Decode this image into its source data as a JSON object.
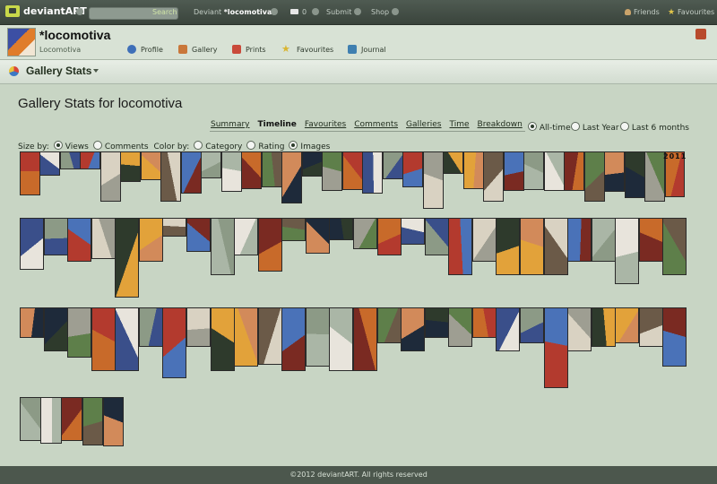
{
  "topbar": {
    "logo_text": "deviantART",
    "search_button": "Search",
    "deviant_label": "Deviant",
    "deviant_name": "*locomotiva",
    "messages_count": "0",
    "submit_label": "Submit",
    "shop_label": "Shop",
    "friends_label": "Friends",
    "favourites_label": "Favourites"
  },
  "profile": {
    "username": "*locomotiva",
    "subname": "Locomotiva",
    "nav": {
      "profile": "Profile",
      "gallery": "Gallery",
      "prints": "Prints",
      "favourites": "Favourites",
      "journal": "Journal"
    }
  },
  "gallery_stats_bar": {
    "title": "Gallery Stats"
  },
  "main": {
    "title": "Gallery Stats for locomotiva",
    "tabs": [
      "Summary",
      "Timeline",
      "Favourites",
      "Comments",
      "Galleries",
      "Time",
      "Breakdown"
    ],
    "active_tab": "Timeline",
    "period_options": [
      "All-time",
      "Last Year",
      "Last 6 months"
    ],
    "period_selected": "All-time",
    "size_by_label": "Size by:",
    "size_by_options": [
      "Views",
      "Comments"
    ],
    "size_by_selected": "Views",
    "color_by_label": "Color by:",
    "color_by_options": [
      "Category",
      "Rating",
      "Images"
    ],
    "color_by_selected": "Images",
    "year_label": "2011",
    "thumbnail_colors": [
      "#c86a2a",
      "#3a4f8a",
      "#8c9a86",
      "#b33a2e",
      "#d9d2c2",
      "#2e3a2c",
      "#e2a23a",
      "#6b5a48",
      "#4a72b8",
      "#aab6a6",
      "#e8e4dc",
      "#7a2a22",
      "#5e7f4a",
      "#d28a5a",
      "#1e2a3a",
      "#9e9e92"
    ]
  },
  "footer": {
    "copyright": "©2012 deviantART. All rights reserved"
  }
}
